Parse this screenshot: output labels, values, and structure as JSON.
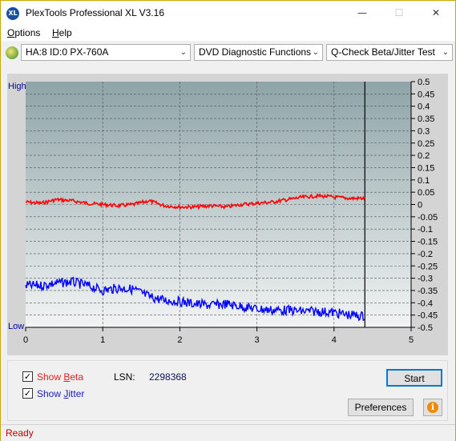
{
  "titlebar": {
    "title": "PlexTools Professional XL V3.16",
    "icon_text": "XL",
    "minimize": "—",
    "maximize": "☐",
    "close": "✕"
  },
  "menu": [
    {
      "label": "Options",
      "underline": "O",
      "rest": "ptions"
    },
    {
      "label": "Help",
      "underline": "H",
      "rest": "elp"
    }
  ],
  "toolbar": {
    "drive": "HA:8 ID:0  PX-760A",
    "function": "DVD Diagnostic Functions",
    "test": "Q-Check Beta/Jitter Test"
  },
  "chart_data": {
    "type": "line",
    "x_ticks": [
      "0",
      "1",
      "2",
      "3",
      "4",
      "5"
    ],
    "xlim": [
      0,
      5
    ],
    "y_right_ticks": [
      "0.5",
      "0.45",
      "0.4",
      "0.35",
      "0.3",
      "0.25",
      "0.2",
      "0.15",
      "0.1",
      "0.05",
      "0",
      "-0.05",
      "-0.1",
      "-0.15",
      "-0.2",
      "-0.25",
      "-0.3",
      "-0.35",
      "-0.4",
      "-0.45",
      "-0.5"
    ],
    "ylim": [
      -0.5,
      0.5
    ],
    "y_left_labels": {
      "top": "High",
      "bottom": "Low"
    },
    "end_marker_x": 4.4,
    "grid": true,
    "series": [
      {
        "color": "#ff0000",
        "x": [
          0,
          0.2,
          0.4,
          0.6,
          0.8,
          1.0,
          1.2,
          1.4,
          1.6,
          1.8,
          2.0,
          2.2,
          2.4,
          2.6,
          2.8,
          3.0,
          3.2,
          3.4,
          3.6,
          3.8,
          4.0,
          4.2,
          4.4
        ],
        "y": [
          0.01,
          0.005,
          0.02,
          0.015,
          0.005,
          0.0,
          -0.005,
          0.0,
          0.015,
          -0.005,
          -0.01,
          -0.01,
          -0.005,
          -0.01,
          0.0,
          0.005,
          0.01,
          0.02,
          0.03,
          0.035,
          0.03,
          0.025,
          0.025
        ]
      },
      {
        "color": "#0000ff",
        "x": [
          0,
          0.2,
          0.4,
          0.6,
          0.8,
          1.0,
          1.2,
          1.4,
          1.6,
          1.8,
          2.0,
          2.2,
          2.4,
          2.6,
          2.8,
          3.0,
          3.2,
          3.4,
          3.6,
          3.8,
          4.0,
          4.2,
          4.4
        ],
        "y": [
          -0.33,
          -0.33,
          -0.32,
          -0.315,
          -0.33,
          -0.35,
          -0.34,
          -0.345,
          -0.375,
          -0.39,
          -0.395,
          -0.405,
          -0.41,
          -0.405,
          -0.415,
          -0.425,
          -0.43,
          -0.43,
          -0.435,
          -0.435,
          -0.44,
          -0.45,
          -0.455
        ]
      }
    ]
  },
  "controls": {
    "show_beta": {
      "label": "Show ",
      "underline": "B",
      "rest": "eta",
      "checked": "✓",
      "color": "#e02020"
    },
    "show_jitter": {
      "label": "Show ",
      "underline": "J",
      "rest": "itter",
      "checked": "✓",
      "color": "#2020c0"
    },
    "lsn_label": "LSN:",
    "lsn_value": "2298368",
    "start": "Start",
    "preferences": "Preferences",
    "info_icon": "i"
  },
  "status": {
    "text": "Ready",
    "color": "#c00000"
  }
}
